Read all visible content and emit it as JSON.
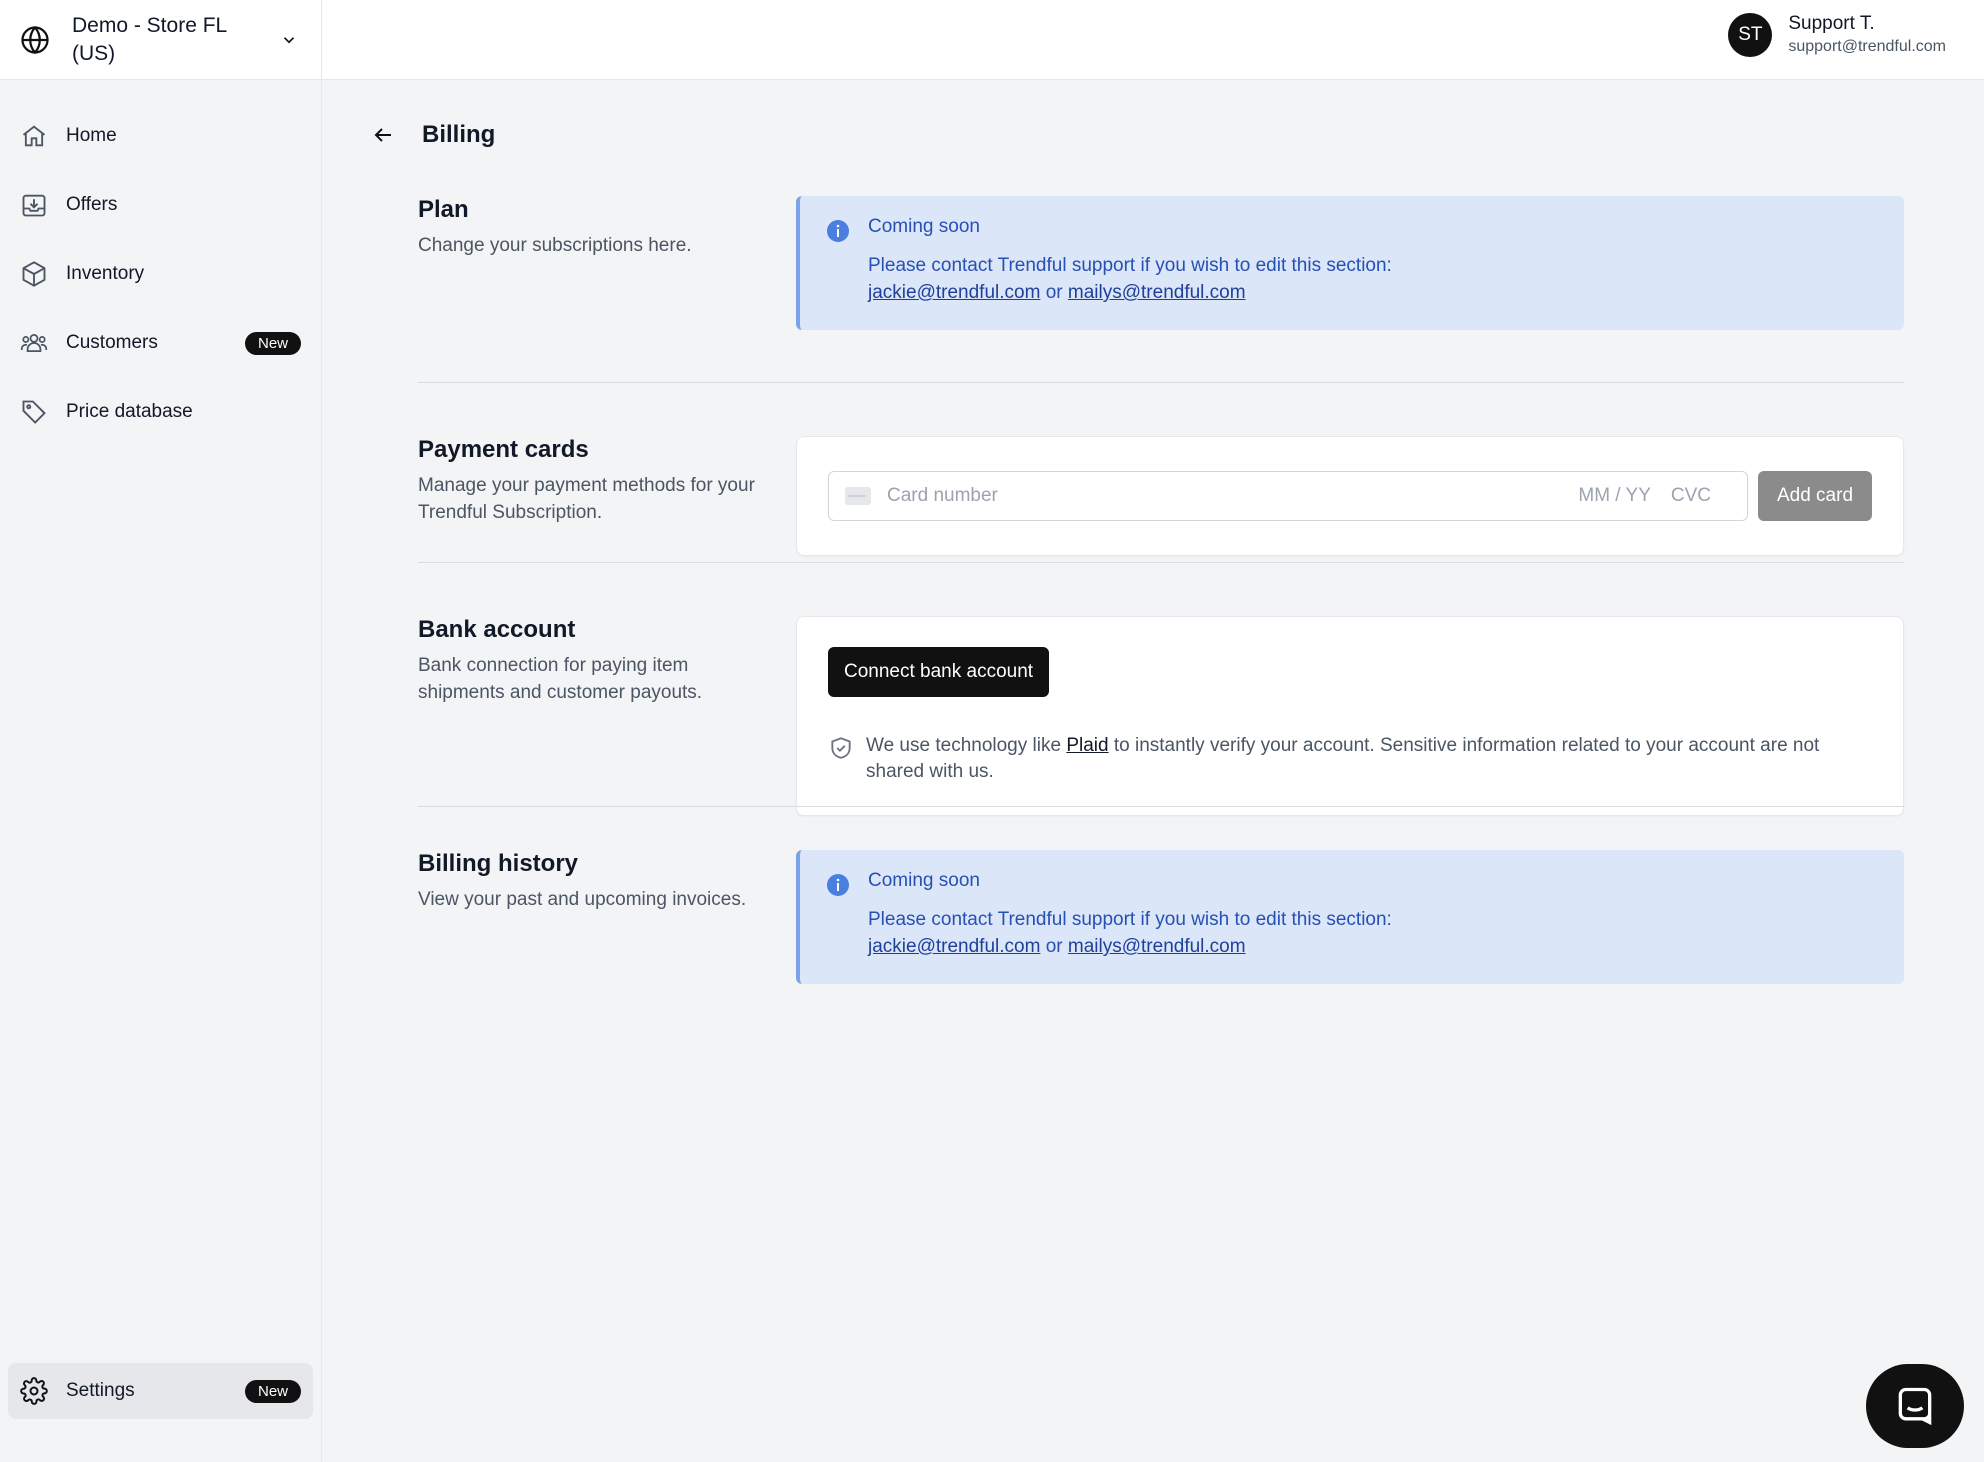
{
  "store": {
    "name": "Demo - Store FL (US)"
  },
  "user": {
    "initials": "ST",
    "name": "Support T.",
    "email": "support@trendful.com"
  },
  "nav": {
    "items": [
      {
        "label": "Home",
        "icon": "home-icon"
      },
      {
        "label": "Offers",
        "icon": "inbox-download-icon"
      },
      {
        "label": "Inventory",
        "icon": "cube-icon"
      },
      {
        "label": "Customers",
        "icon": "users-icon",
        "badge": "New"
      },
      {
        "label": "Price database",
        "icon": "tag-icon"
      }
    ],
    "settings": {
      "label": "Settings",
      "icon": "gear-icon",
      "badge": "New"
    }
  },
  "page": {
    "title": "Billing"
  },
  "sections": {
    "plan": {
      "title": "Plan",
      "description": "Change your subscriptions here.",
      "notice": {
        "title": "Coming soon",
        "text": "Please contact Trendful support if you wish to edit this section:",
        "email1": "jackie@trendful.com",
        "or": "or",
        "email2": "mailys@trendful.com"
      }
    },
    "payment": {
      "title": "Payment cards",
      "description": "Manage your payment methods for your Trendful Subscription.",
      "card_number_placeholder": "Card number",
      "expiry_placeholder": "MM / YY",
      "cvc_placeholder": "CVC",
      "add_card_label": "Add card"
    },
    "bank": {
      "title": "Bank account",
      "description": "Bank connection for paying item shipments and customer payouts.",
      "connect_label": "Connect bank account",
      "note_before": "We use technology like ",
      "note_link": "Plaid",
      "note_after": " to instantly verify your account. Sensitive information related to your account are not shared with us."
    },
    "history": {
      "title": "Billing history",
      "description": "View your past and upcoming invoices.",
      "notice": {
        "title": "Coming soon",
        "text": "Please contact Trendful support if you wish to edit this section:",
        "email1": "jackie@trendful.com",
        "or": "or",
        "email2": "mailys@trendful.com"
      }
    }
  },
  "colors": {
    "info_bg": "#dbe6f9",
    "info_text": "#2750b4",
    "info_border": "#7ba3ea",
    "primary": "#111111",
    "disabled_button": "#8b8b8b"
  }
}
